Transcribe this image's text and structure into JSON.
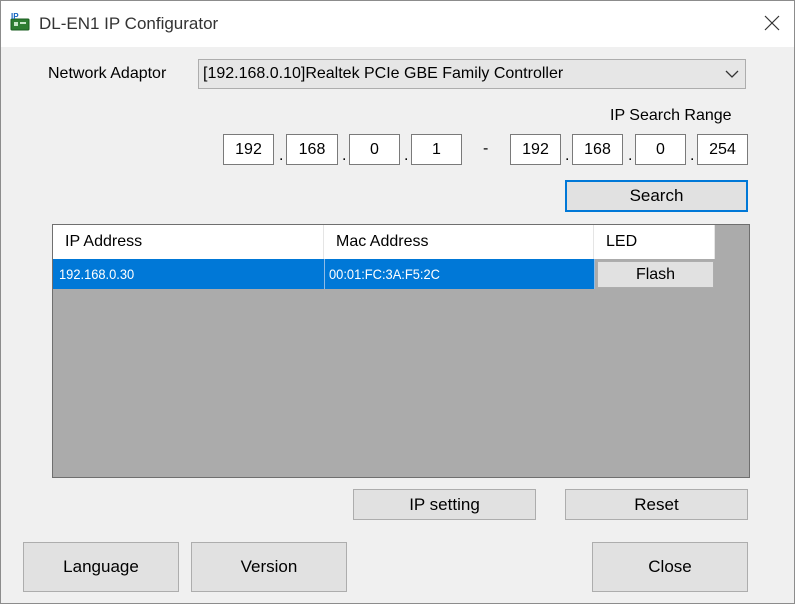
{
  "window": {
    "title": "DL-EN1 IP Configurator"
  },
  "network": {
    "label": "Network Adaptor",
    "selected": "[192.168.0.10]Realtek PCIe GBE Family Controller"
  },
  "search_range": {
    "label": "IP Search Range",
    "start": [
      "192",
      "168",
      "0",
      "1"
    ],
    "end": [
      "192",
      "168",
      "0",
      "254"
    ],
    "separator": "-",
    "dot": "."
  },
  "buttons": {
    "search": "Search",
    "ip_setting": "IP setting",
    "reset": "Reset",
    "language": "Language",
    "version": "Version",
    "close": "Close"
  },
  "table": {
    "headers": [
      "IP Address",
      "Mac Address",
      "LED"
    ],
    "rows": [
      {
        "ip": "192.168.0.30",
        "mac": "00:01:FC:3A:F5:2C",
        "led": "Flash"
      }
    ]
  },
  "colors": {
    "selection": "#0078d7",
    "focus_border": "#0078d7"
  }
}
